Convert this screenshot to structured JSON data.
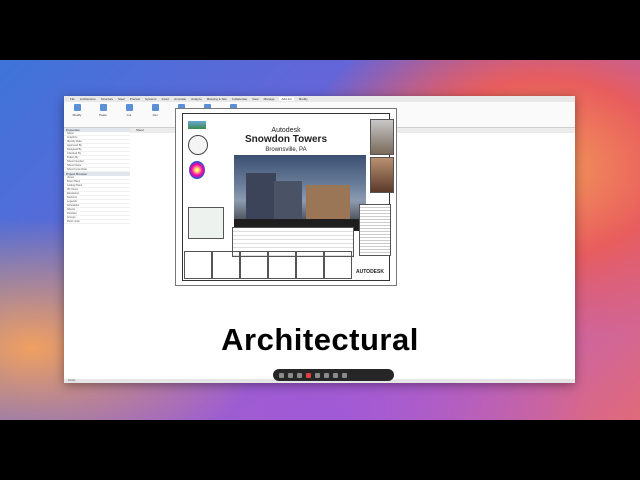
{
  "app": {
    "tabs": [
      "File",
      "Architecture",
      "Structure",
      "Steel",
      "Precast",
      "Systems",
      "Insert",
      "Annotate",
      "Analyze",
      "Massing & Site",
      "Collaborate",
      "View",
      "Manage",
      "Add-Ins",
      "Modify"
    ],
    "active_tab": "Add-Ins",
    "ribbon_buttons": [
      "Modify",
      "Paste",
      "Cut",
      "Join",
      "Pin",
      "Properties",
      "Preview"
    ],
    "view_tab": "Sheet",
    "status_text": "Ready"
  },
  "left_panel": {
    "properties_header": "Properties",
    "browser_header": "Project Browser",
    "rows": [
      "Sheet",
      "Graphics",
      "Identity Data",
      "Approved By",
      "Designed By",
      "Checked By",
      "Drawn By",
      "Sheet Number",
      "Sheet Name",
      "Sheet Issue Date",
      "Views",
      "Floor Plans",
      "Ceiling Plans",
      "3D Views",
      "Elevations",
      "Sections",
      "Legends",
      "Schedules",
      "Sheets",
      "Families",
      "Groups",
      "Revit Links"
    ]
  },
  "sheet": {
    "brand": "Autodesk",
    "title": "Snowdon Towers",
    "location": "Brownsville, PA",
    "footer_logo": "AUTODESK"
  },
  "caption": "Architectural",
  "colors": {
    "accent": "#2a6cc4",
    "caption": "#000000"
  }
}
